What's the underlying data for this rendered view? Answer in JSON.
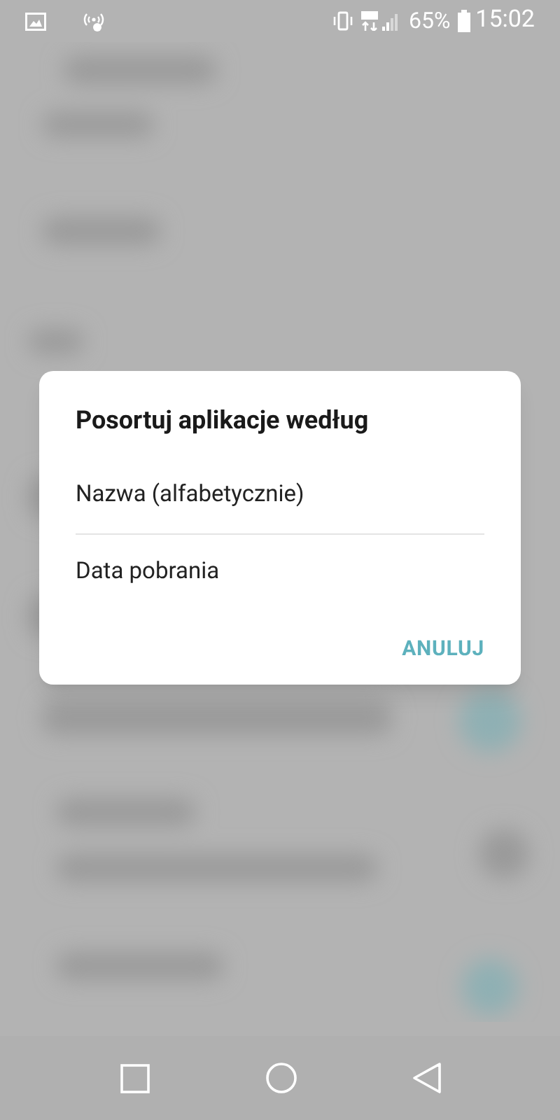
{
  "status_bar": {
    "battery_percent": "65%",
    "time": "15:02"
  },
  "dialog": {
    "title": "Posortuj aplikacje według",
    "options": [
      {
        "label": "Nazwa (alfabetycznie)"
      },
      {
        "label": "Data pobrania"
      }
    ],
    "cancel_button": "ANULUJ"
  }
}
